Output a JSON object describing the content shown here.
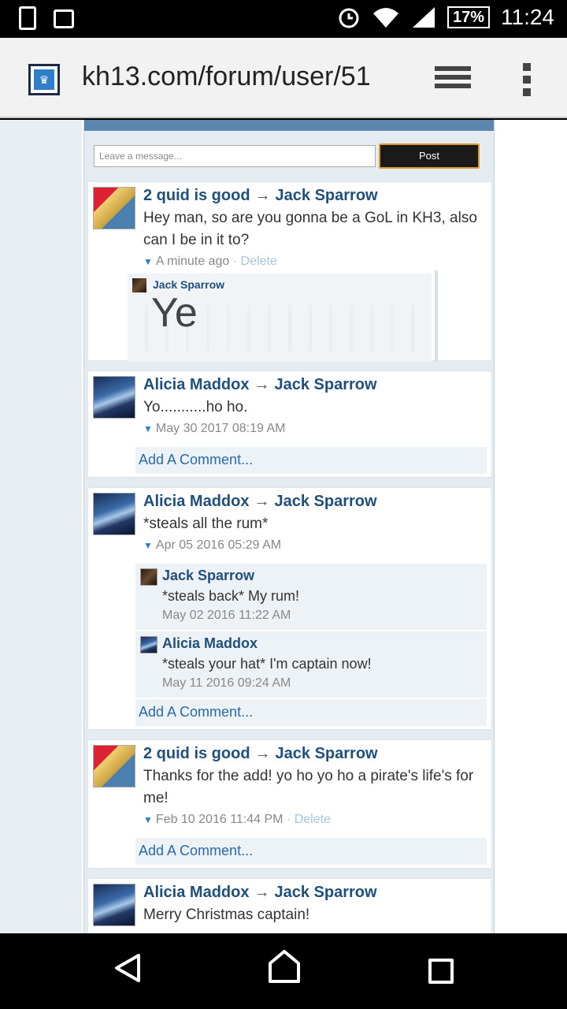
{
  "status_bar": {
    "battery": "17%",
    "time": "11:24"
  },
  "browser": {
    "url": "kh13.com/forum/user/51"
  },
  "composer": {
    "placeholder": "Leave a message...",
    "post_label": "Post"
  },
  "posts": [
    {
      "from": "2 quid is good",
      "arrow": "→",
      "to": "Jack Sparrow",
      "text": "Hey man, so are you gonna be a GoL in KH3, also can I be in it to?",
      "time": "A minute ago",
      "sep": "·",
      "delete": "Delete",
      "inline_reply": {
        "name": "Jack Sparrow",
        "text": "Ye"
      }
    },
    {
      "from": "Alicia Maddox",
      "arrow": "→",
      "to": "Jack Sparrow",
      "text": "Yo...........ho ho.",
      "time": "May 30 2017 08:19 AM",
      "add_comment": "Add A Comment..."
    },
    {
      "from": "Alicia Maddox",
      "arrow": "→",
      "to": "Jack Sparrow",
      "text": "*steals all the rum*",
      "time": "Apr 05 2016 05:29 AM",
      "replies": [
        {
          "name": "Jack Sparrow",
          "text": "*steals back* My rum!",
          "time": "May 02 2016 11:22 AM"
        },
        {
          "name": "Alicia Maddox",
          "text": "*steals your hat* I'm captain now!",
          "time": "May 11 2016 09:24 AM"
        }
      ],
      "add_comment": "Add A Comment..."
    },
    {
      "from": "2 quid is good",
      "arrow": "→",
      "to": "Jack Sparrow",
      "text": "Thanks for the add! yo ho yo ho a pirate's life's for me!",
      "time": "Feb 10 2016 11:44 PM",
      "sep": "·",
      "delete": "Delete",
      "add_comment": "Add A Comment..."
    },
    {
      "from": "Alicia Maddox",
      "arrow": "→",
      "to": "Jack Sparrow",
      "text": "Merry Christmas captain!"
    }
  ],
  "icons": {
    "status": [
      "sim-alert-icon",
      "image-icon",
      "alarm-icon",
      "wifi-icon",
      "signal-icon"
    ],
    "browser": [
      "site-favicon",
      "tabs-icon",
      "overflow-menu-icon"
    ],
    "nav": [
      "back-icon",
      "home-icon",
      "recent-apps-icon"
    ]
  },
  "colors": {
    "link": "#1f4f7a",
    "accent": "#2f7fc6",
    "post_button_border": "#d99a2b"
  }
}
